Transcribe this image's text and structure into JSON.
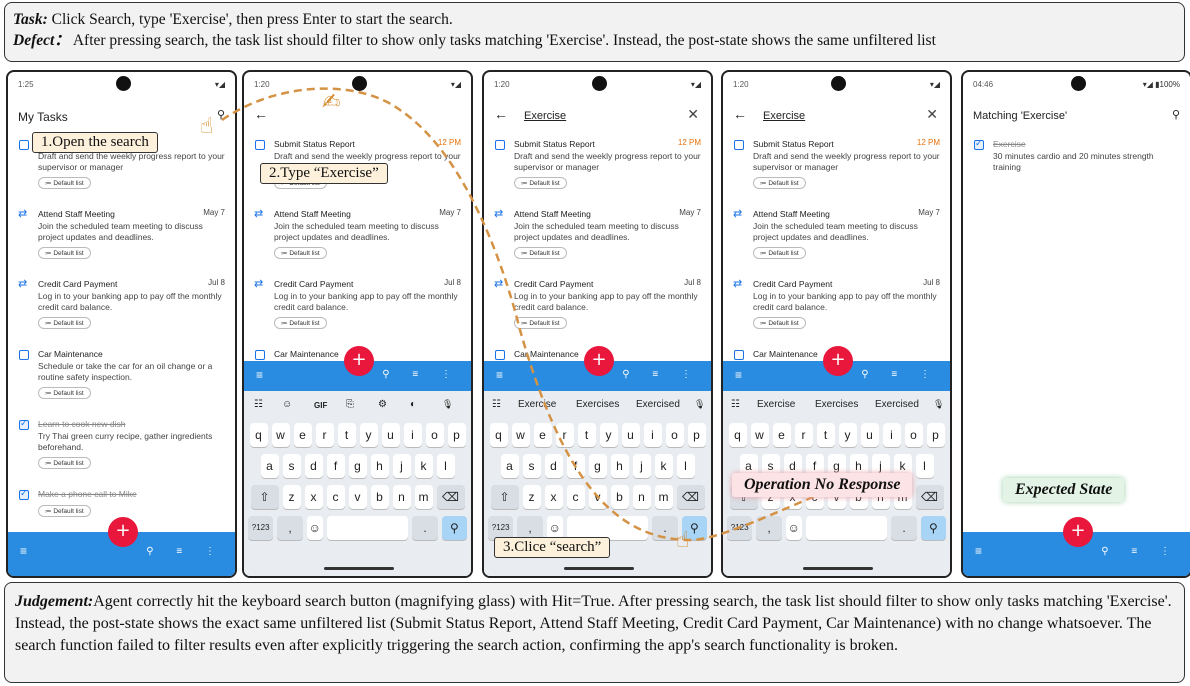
{
  "task": {
    "label": "Task:",
    "text": " Click Search, type 'Exercise', then press Enter to start the search."
  },
  "defect": {
    "label": "Defect：",
    "text": " After pressing search, the task list should filter to show only tasks matching 'Exercise'. Instead, the post-state shows the same unfiltered list"
  },
  "judgement": {
    "label": "Judgement:",
    "text": "Agent correctly hit the keyboard search button (magnifying glass) with Hit=True. After pressing search, the task list should filter to show only tasks matching 'Exercise'. Instead, the post-state shows the exact same unfiltered list (Submit Status Report, Attend Staff Meeting, Credit Card Payment, Car Maintenance) with no change whatsoever. The search function failed to filter results even after explicitly triggering the search action, confirming the app's search functionality is broken."
  },
  "callouts": {
    "step1": "1.Open the search",
    "step2": "2.Type “Exercise”",
    "step3": "3.Clice “search”",
    "no_response": "Operation No Response",
    "expected": "Expected State"
  },
  "phone1": {
    "time": "1:25",
    "title": "My Tasks",
    "tasks": [
      {
        "title": "Submit Status Report",
        "desc": "Draft and send the weekly progress report to your supervisor or manager",
        "chip": "Default list"
      },
      {
        "title": "Attend Staff Meeting",
        "date": "May 7",
        "desc": "Join the scheduled team meeting to discuss project updates and deadlines.",
        "chip": "Default list"
      },
      {
        "title": "Credit Card Payment",
        "date": "Jul 8",
        "desc": "Log in to your banking app to pay off the monthly credit card balance.",
        "chip": "Default list"
      },
      {
        "title": "Car Maintenance",
        "desc": "Schedule or take the car for an oil change or a routine safety inspection.",
        "chip": "Default list"
      },
      {
        "title": "Learn to cook new dish",
        "desc": "Try Thai green curry recipe, gather ingredients beforehand.",
        "chip": "Default list"
      },
      {
        "title": "Make a phone call to Mike",
        "chip": "Default list"
      }
    ]
  },
  "phone2": {
    "time": "1:20"
  },
  "phone3": {
    "time": "1:20",
    "query": "Exercise"
  },
  "phone4": {
    "time": "1:20",
    "query": "Exercise"
  },
  "phone5": {
    "time": "04:46",
    "battery": "100%",
    "title": "Matching 'Exercise'",
    "task": {
      "title": "Exercise",
      "desc": "30 minutes cardio and 20 minutes strength training"
    }
  },
  "shared_tasks": [
    {
      "title": "Submit Status Report",
      "date": "12 PM",
      "desc": "Draft and send the weekly progress report to your supervisor or manager",
      "chip": "Default list"
    },
    {
      "title": "Attend Staff Meeting",
      "date": "May 7",
      "desc": "Join the scheduled team meeting to discuss project updates and deadlines.",
      "chip": "Default list"
    },
    {
      "title": "Credit Card Payment",
      "date": "Jul 8",
      "desc": "Log in to your banking app to pay off the monthly credit card balance.",
      "chip": "Default list"
    },
    {
      "title": "Car Maintenance"
    }
  ],
  "keyboard": {
    "toolbar": [
      "☷",
      "☺",
      "GIF",
      "⎘",
      "⚙",
      "◐",
      "🎙"
    ],
    "suggestions": [
      "Exercise",
      "Exercises",
      "Exercised"
    ],
    "row1": [
      "q",
      "w",
      "e",
      "r",
      "t",
      "y",
      "u",
      "i",
      "o",
      "p"
    ],
    "row2": [
      "a",
      "s",
      "d",
      "f",
      "g",
      "h",
      "j",
      "k",
      "l"
    ],
    "row3": [
      "z",
      "x",
      "c",
      "v",
      "b",
      "n",
      "m"
    ],
    "sym": "?123"
  },
  "colors": {
    "accent": "#2a8ce0",
    "fab": "#e8173b",
    "date_red": "#e8710a"
  }
}
